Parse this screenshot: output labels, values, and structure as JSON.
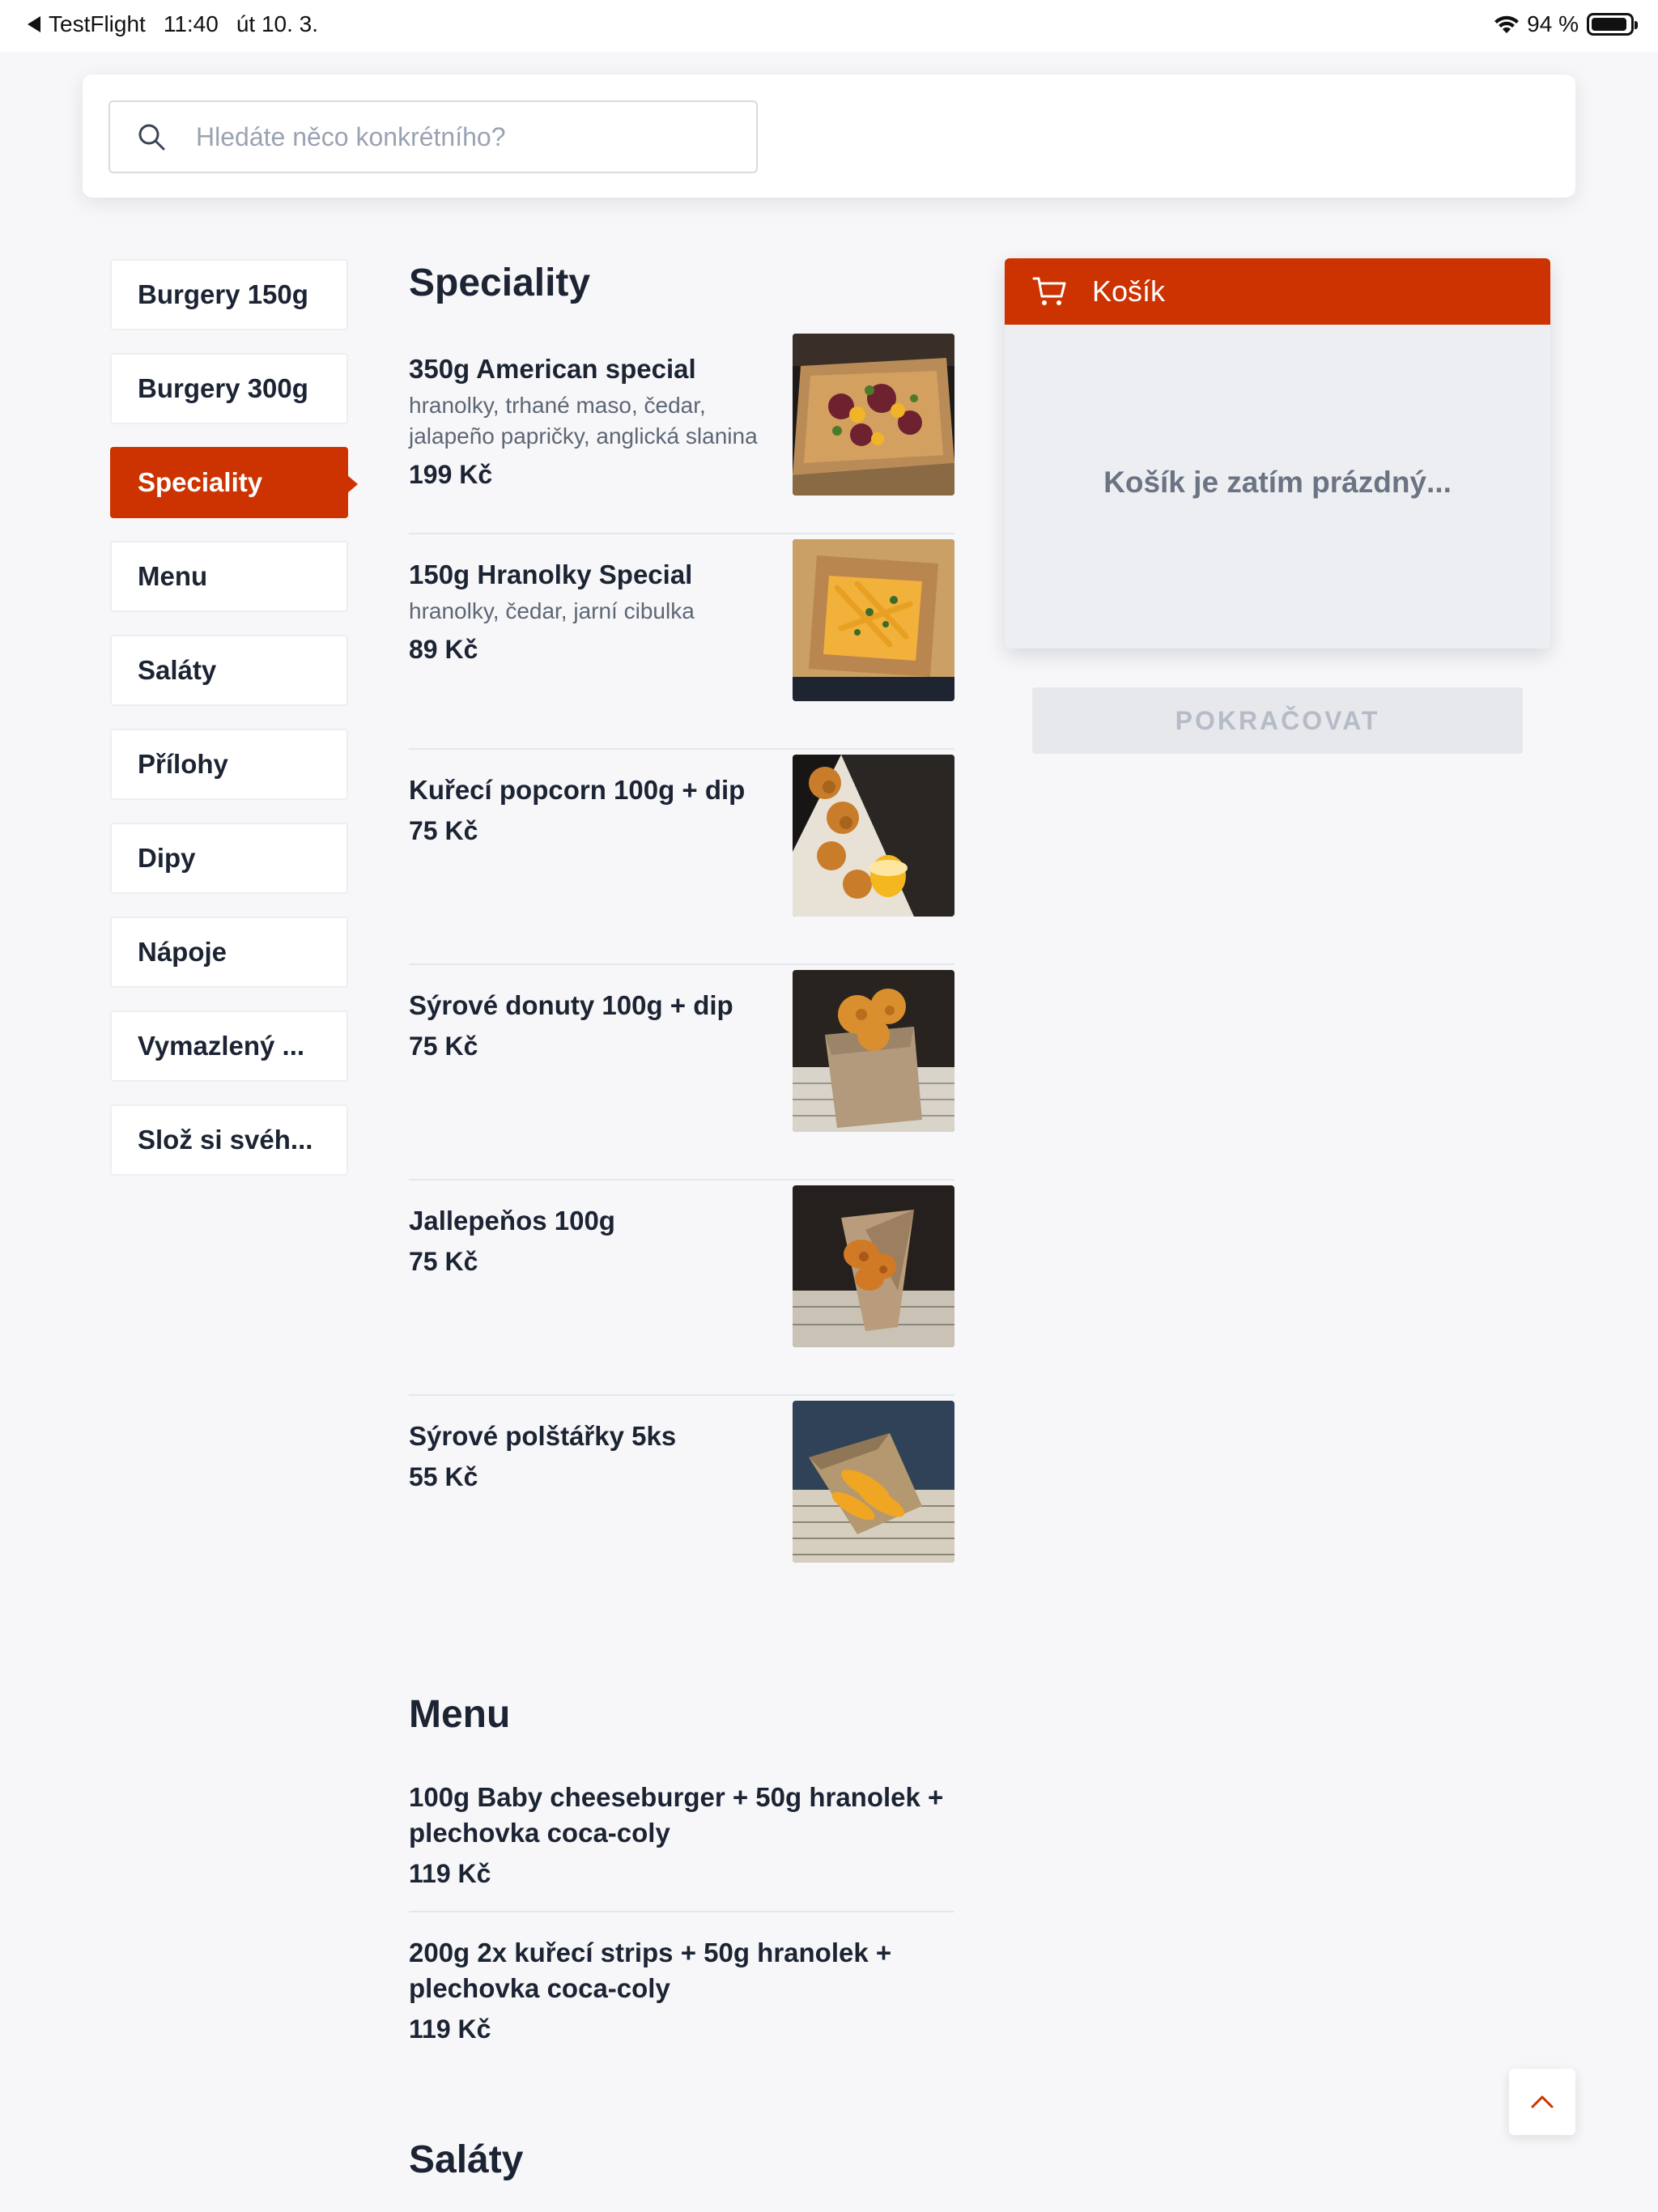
{
  "status_bar": {
    "back_app": "TestFlight",
    "time": "11:40",
    "date": "út 10. 3.",
    "battery": "94 %",
    "battery_level": 0.94
  },
  "search": {
    "placeholder": "Hledáte něco konkrétního?",
    "value": ""
  },
  "sidebar": {
    "items": [
      {
        "label": "Burgery 150g",
        "active": false
      },
      {
        "label": "Burgery 300g",
        "active": false
      },
      {
        "label": "Speciality",
        "active": true
      },
      {
        "label": "Menu",
        "active": false
      },
      {
        "label": "Saláty",
        "active": false
      },
      {
        "label": "Přílohy",
        "active": false
      },
      {
        "label": "Dipy",
        "active": false
      },
      {
        "label": "Nápoje",
        "active": false
      },
      {
        "label": "Vymazlený ...",
        "active": false
      },
      {
        "label": "Slož si svéh...",
        "active": false
      }
    ]
  },
  "sections": [
    {
      "title": "Speciality",
      "products": [
        {
          "name": "350g American special",
          "desc": "hranolky, trhané maso, čedar, jalapeño papričky, anglická slanina",
          "price": "199 Kč",
          "image": "fries-loaded-box"
        },
        {
          "name": "150g Hranolky Special",
          "desc": "hranolky, čedar, jarní cibulka",
          "price": "89 Kč",
          "image": "fries-cheese-box"
        },
        {
          "name": "Kuřecí popcorn 100g + dip",
          "desc": "",
          "price": "75 Kč",
          "image": "chicken-popcorn"
        },
        {
          "name": "Sýrové donuty 100g + dip",
          "desc": "",
          "price": "75 Kč",
          "image": "cheese-donuts"
        },
        {
          "name": "Jallepeňos 100g",
          "desc": "",
          "price": "75 Kč",
          "image": "jalapenos"
        },
        {
          "name": "Sýrové polštářky 5ks",
          "desc": "",
          "price": "55 Kč",
          "image": "cheese-pillows"
        }
      ]
    },
    {
      "title": "Menu",
      "products": [
        {
          "name": "100g Baby cheeseburger + 50g hranolek + plechovka coca-coly",
          "desc": "",
          "price": "119 Kč"
        },
        {
          "name": "200g 2x kuřecí strips + 50g hranolek + plechovka coca-coly",
          "desc": "",
          "price": "119 Kč"
        }
      ]
    },
    {
      "title": "Saláty",
      "products": []
    }
  ],
  "cart": {
    "title": "Košík",
    "empty_text": "Košík je zatím prázdný...",
    "continue_label": "POKRAČOVAT"
  },
  "colors": {
    "accent": "#cc3300",
    "text": "#1c2434",
    "muted": "#6b7484"
  }
}
